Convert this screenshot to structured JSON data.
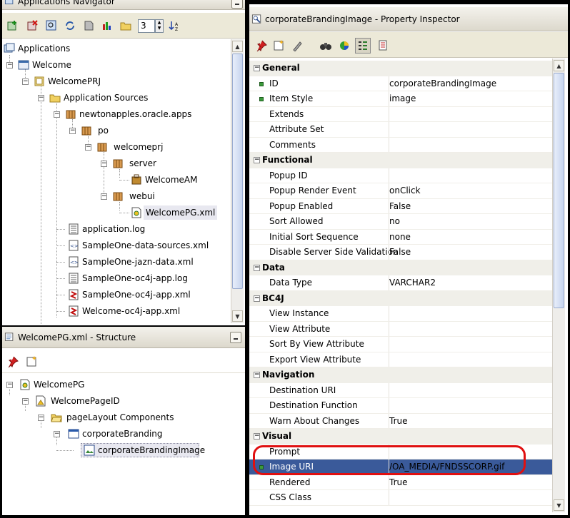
{
  "app_nav": {
    "title": "Applications Navigator",
    "spinner_value": "3",
    "tree": [
      {
        "label": "Applications"
      },
      {
        "label": "Welcome"
      },
      {
        "label": "WelcomePRJ"
      },
      {
        "label": "Application Sources"
      },
      {
        "label": "newtonapples.oracle.apps"
      },
      {
        "label": "po"
      },
      {
        "label": "welcomeprj"
      },
      {
        "label": "server"
      },
      {
        "label": "WelcomeAM"
      },
      {
        "label": "webui"
      },
      {
        "label": "WelcomePG.xml"
      },
      {
        "label": "application.log"
      },
      {
        "label": "SampleOne-data-sources.xml"
      },
      {
        "label": "SampleOne-jazn-data.xml"
      },
      {
        "label": "SampleOne-oc4j-app.log"
      },
      {
        "label": "SampleOne-oc4j-app.xml"
      },
      {
        "label": "Welcome-oc4j-app.xml"
      }
    ]
  },
  "structure": {
    "title": "WelcomePG.xml - Structure",
    "tree": [
      {
        "label": "WelcomePG"
      },
      {
        "label": "WelcomePageID"
      },
      {
        "label": "pageLayout Components"
      },
      {
        "label": "corporateBranding"
      },
      {
        "label": "corporateBrandingImage"
      }
    ]
  },
  "inspector": {
    "title": "corporateBrandingImage - Property Inspector",
    "rows": [
      {
        "type": "category",
        "name": "General"
      },
      {
        "name": "ID",
        "value": "corporateBrandingImage",
        "required": true
      },
      {
        "name": "Item Style",
        "value": "image",
        "required": true
      },
      {
        "name": "Extends",
        "value": ""
      },
      {
        "name": "Attribute Set",
        "value": ""
      },
      {
        "name": "Comments",
        "value": ""
      },
      {
        "type": "category",
        "name": "Functional"
      },
      {
        "name": "Popup ID",
        "value": ""
      },
      {
        "name": "Popup Render Event",
        "value": "onClick"
      },
      {
        "name": "Popup Enabled",
        "value": "False"
      },
      {
        "name": "Sort Allowed",
        "value": "no"
      },
      {
        "name": "Initial Sort Sequence",
        "value": "none"
      },
      {
        "name": "Disable Server Side Validation",
        "value": "False"
      },
      {
        "type": "category",
        "name": "Data"
      },
      {
        "name": "Data Type",
        "value": "VARCHAR2"
      },
      {
        "type": "category",
        "name": "BC4J"
      },
      {
        "name": "View Instance",
        "value": ""
      },
      {
        "name": "View Attribute",
        "value": ""
      },
      {
        "name": "Sort By View Attribute",
        "value": ""
      },
      {
        "name": "Export View Attribute",
        "value": ""
      },
      {
        "type": "category",
        "name": "Navigation"
      },
      {
        "name": "Destination URI",
        "value": ""
      },
      {
        "name": "Destination Function",
        "value": ""
      },
      {
        "name": "Warn About Changes",
        "value": "True"
      },
      {
        "type": "category",
        "name": "Visual"
      },
      {
        "name": "Prompt",
        "value": ""
      },
      {
        "name": "Image URI",
        "value": "/OA_MEDIA/FNDSSCORP.gif",
        "required": true,
        "highlight": true
      },
      {
        "name": "Rendered",
        "value": "True"
      },
      {
        "name": "CSS Class",
        "value": ""
      }
    ]
  },
  "colors": {
    "selection": "#e8e8f0",
    "highlight_ring": "#e01010",
    "category_bg": "#f0efe9",
    "header_bg": "#e4e0d4"
  },
  "icons": [
    "folder-icon",
    "package-icon",
    "project-icon",
    "application-icon",
    "xml-file-icon",
    "log-file-icon",
    "pushpin-icon",
    "binoculars-icon"
  ]
}
